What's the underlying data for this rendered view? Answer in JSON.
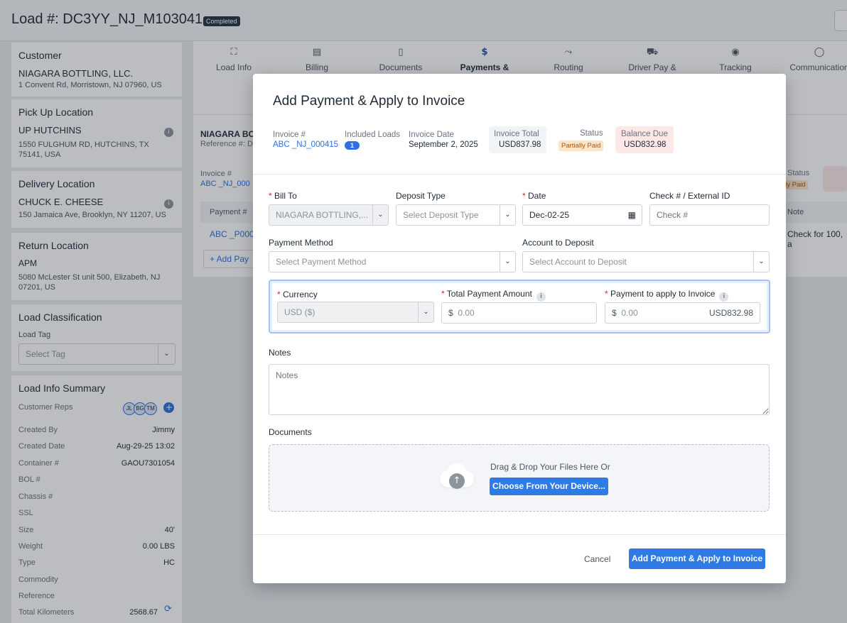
{
  "header": {
    "title": "Load #: DC3YY_NJ_M103041",
    "status": "Completed"
  },
  "sidebar": {
    "customer": {
      "heading": "Customer",
      "name": "NIAGARA BOTTLING, LLC.",
      "address": "1 Convent Rd, Morristown, NJ 07960, US"
    },
    "pickup": {
      "heading": "Pick Up Location",
      "name": "UP HUTCHINS",
      "address": "1550 FULGHUM RD, HUTCHINS, TX 75141, USA"
    },
    "delivery": {
      "heading": "Delivery Location",
      "name": "CHUCK E. CHEESE",
      "address": "150 Jamaica Ave, Brooklyn, NY 11207, US"
    },
    "return": {
      "heading": "Return Location",
      "name": "APM",
      "address": "5080 McLester St unit 500, Elizabeth, NJ 07201, US"
    },
    "classification": {
      "heading": "Load Classification",
      "tag_label": "Load Tag",
      "tag_placeholder": "Select Tag"
    },
    "summary": {
      "heading": "Load Info Summary",
      "reps_label": "Customer Reps",
      "reps": [
        "JL",
        "BG",
        "TM"
      ],
      "rows": [
        {
          "label": "Created By",
          "value": "Jimmy"
        },
        {
          "label": "Created Date",
          "value": "Aug-29-25 13:02"
        },
        {
          "label": "Container #",
          "value": "GAOU7301054"
        },
        {
          "label": "BOL #",
          "value": ""
        },
        {
          "label": "Chassis #",
          "value": ""
        },
        {
          "label": "SSL",
          "value": ""
        },
        {
          "label": "Size",
          "value": "40'"
        },
        {
          "label": "Weight",
          "value": "0.00 LBS"
        },
        {
          "label": "Type",
          "value": "HC"
        },
        {
          "label": "Commodity",
          "value": ""
        },
        {
          "label": "Reference",
          "value": ""
        },
        {
          "label": "Total Kilometers",
          "value": "2568.67"
        }
      ]
    }
  },
  "tabs": [
    {
      "label": "Load Info",
      "icon": "expand-icon"
    },
    {
      "label": "Billing",
      "icon": "billing-icon"
    },
    {
      "label": "Documents",
      "icon": "document-icon"
    },
    {
      "label": "Payments &",
      "icon": "dollar-circle-icon"
    },
    {
      "label": "Routing",
      "icon": "routing-icon"
    },
    {
      "label": "Driver Pay &",
      "icon": "truck-icon"
    },
    {
      "label": "Tracking",
      "icon": "pin-icon"
    },
    {
      "label": "Communication",
      "icon": "chat-icon"
    }
  ],
  "background_panel": {
    "customer": "NIAGARA BO",
    "reference": "Reference #: D",
    "invoice_label": "Invoice #",
    "invoice_value": "ABC _NJ_000",
    "status_label": "Status",
    "status_value": "lly Paid",
    "col_payment": "Payment #",
    "col_note": "Note",
    "row_payment": "ABC _P000",
    "row_note": "Check for 100, a",
    "add_payment": "+ Add Pay"
  },
  "modal": {
    "title": "Add Payment & Apply to Invoice",
    "summary": {
      "invoice_label": "Invoice #",
      "invoice_value": "ABC _NJ_000415",
      "loads_label": "Included Loads",
      "loads_value": "1",
      "date_label": "Invoice Date",
      "date_value": "September 2, 2025",
      "total_label": "Invoice Total",
      "total_value": "USD837.98",
      "status_label": "Status",
      "status_value": "Partially Paid",
      "balance_label": "Balance Due",
      "balance_value": "USD832.98"
    },
    "fields": {
      "bill_to_label": "Bill To",
      "bill_to_value": "NIAGARA BOTTLING,...",
      "deposit_type_label": "Deposit Type",
      "deposit_type_placeholder": "Select Deposit Type",
      "date_label": "Date",
      "date_value": "Dec-02-25",
      "check_label": "Check # / External ID",
      "check_placeholder": "Check #",
      "payment_method_label": "Payment Method",
      "payment_method_placeholder": "Select Payment Method",
      "account_label": "Account to Deposit",
      "account_placeholder": "Select Account to Deposit",
      "currency_label": "Currency",
      "currency_value": "USD ($)",
      "total_payment_label": "Total Payment Amount",
      "total_payment_placeholder": "0.00",
      "apply_label": "Payment to apply to Invoice",
      "apply_placeholder": "0.00",
      "apply_suffix": "USD832.98",
      "currency_symbol": "$",
      "notes_label": "Notes",
      "notes_placeholder": "Notes",
      "documents_label": "Documents",
      "drop_text": "Drag & Drop Your Files Here Or",
      "choose_button": "Choose From Your Device..."
    },
    "footer": {
      "cancel": "Cancel",
      "submit": "Add Payment & Apply to Invoice"
    }
  },
  "colors": {
    "accent": "#2f7be6",
    "link": "#2f6fe0",
    "balance_bg": "#fde8e8",
    "status_bg": "#fde5c7"
  }
}
